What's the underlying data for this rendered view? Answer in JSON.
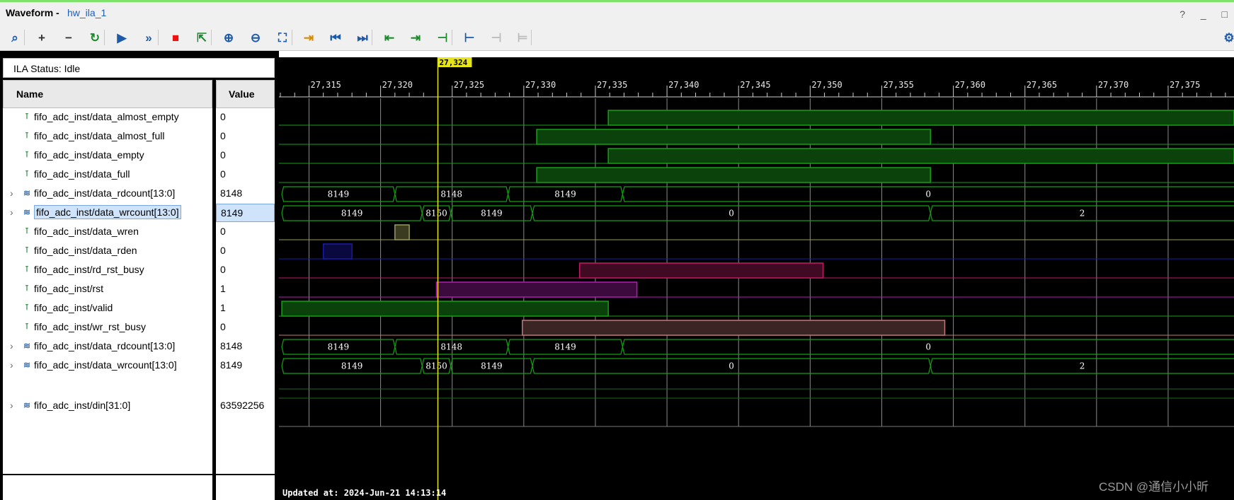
{
  "window": {
    "title": "Waveform -",
    "link": "hw_ila_1",
    "controls": "? _ □"
  },
  "toolbar": {
    "buttons": [
      {
        "name": "search-icon",
        "glyph": "⌕"
      },
      {
        "name": "add-icon",
        "glyph": "+"
      },
      {
        "name": "remove-icon",
        "glyph": "−"
      },
      {
        "name": "refresh-icon",
        "glyph": "↻"
      },
      {
        "name": "run-trigger-icon",
        "glyph": "▶"
      },
      {
        "name": "run-immediate-icon",
        "glyph": "»"
      },
      {
        "name": "stop-icon",
        "glyph": "■"
      },
      {
        "name": "export-icon",
        "glyph": "⇱"
      },
      {
        "name": "zoom-in-icon",
        "glyph": "⊕"
      },
      {
        "name": "zoom-out-icon",
        "glyph": "⊖"
      },
      {
        "name": "zoom-fit-icon",
        "glyph": "⛶"
      },
      {
        "name": "goto-cursor-icon",
        "glyph": "⇥"
      },
      {
        "name": "goto-start-icon",
        "glyph": "⏮"
      },
      {
        "name": "goto-end-icon",
        "glyph": "⏭"
      },
      {
        "name": "prev-transition-icon",
        "glyph": "⇤"
      },
      {
        "name": "next-transition-icon",
        "glyph": "⇥"
      },
      {
        "name": "add-marker-icon",
        "glyph": "⊣"
      },
      {
        "name": "prev-marker-icon",
        "glyph": "⊢"
      },
      {
        "name": "next-marker-icon",
        "glyph": "⊣"
      },
      {
        "name": "swap-cursors-icon",
        "glyph": "⊨"
      }
    ],
    "settings_icon": "gear-icon"
  },
  "ila_status": "ILA Status:  Idle",
  "columns": {
    "name": "Name",
    "value": "Value"
  },
  "signals": [
    {
      "name": "fifo_adc_inst/data_almost_empty",
      "value": "0",
      "bus": false
    },
    {
      "name": "fifo_adc_inst/data_almost_full",
      "value": "0",
      "bus": false
    },
    {
      "name": "fifo_adc_inst/data_empty",
      "value": "0",
      "bus": false
    },
    {
      "name": "fifo_adc_inst/data_full",
      "value": "0",
      "bus": false
    },
    {
      "name": "fifo_adc_inst/data_rdcount[13:0]",
      "value": "8148",
      "bus": true
    },
    {
      "name": "fifo_adc_inst/data_wrcount[13:0]",
      "value": "8149",
      "bus": true,
      "selected": true
    },
    {
      "name": "fifo_adc_inst/data_wren",
      "value": "0",
      "bus": false
    },
    {
      "name": "fifo_adc_inst/data_rden",
      "value": "0",
      "bus": false
    },
    {
      "name": "fifo_adc_inst/rd_rst_busy",
      "value": "0",
      "bus": false
    },
    {
      "name": "fifo_adc_inst/rst",
      "value": "1",
      "bus": false
    },
    {
      "name": "fifo_adc_inst/valid",
      "value": "1",
      "bus": false
    },
    {
      "name": "fifo_adc_inst/wr_rst_busy",
      "value": "0",
      "bus": false
    },
    {
      "name": "fifo_adc_inst/data_rdcount[13:0]",
      "value": "8148",
      "bus": true
    },
    {
      "name": "fifo_adc_inst/data_wrcount[13:0]",
      "value": "8149",
      "bus": true
    },
    {
      "name": "fifo_adc_inst/din[31:0]",
      "value": "63592256",
      "bus": true
    }
  ],
  "cursor": {
    "time": 27324,
    "label": "27,324",
    "color": "#e5e51a"
  },
  "timeline": {
    "ticks": [
      27315,
      27320,
      27325,
      27330,
      27335,
      27340,
      27345,
      27350,
      27355,
      27360,
      27365,
      27370,
      27375
    ],
    "tick_labels": [
      "27,315",
      "27,320",
      "27,325",
      "27,330",
      "27,335",
      "27,340",
      "27,345",
      "27,350",
      "27,355",
      "27,360",
      "27,365",
      "27,370",
      "27,375"
    ],
    "start": 27312.9,
    "end": 27379.6
  },
  "waves": [
    {
      "type": "bit",
      "color": "#14a014",
      "fill": "#0b420b",
      "high": [
        [
          27335.9,
          27380
        ]
      ]
    },
    {
      "type": "bit",
      "color": "#14a014",
      "fill": "#0b420b",
      "high": [
        [
          27330.9,
          27358.4
        ]
      ]
    },
    {
      "type": "bit",
      "color": "#14a014",
      "fill": "#0b420b",
      "high": [
        [
          27335.9,
          27380
        ]
      ]
    },
    {
      "type": "bit",
      "color": "#14a014",
      "fill": "#0b420b",
      "high": [
        [
          27330.9,
          27358.4
        ]
      ]
    },
    {
      "type": "bus",
      "color": "#14a014",
      "segments": [
        {
          "from": 27313.1,
          "to": 27321.0,
          "label": "8149"
        },
        {
          "from": 27321.0,
          "to": 27328.9,
          "label": "8148"
        },
        {
          "from": 27328.9,
          "to": 27336.9,
          "label": "8149"
        },
        {
          "from": 27336.9,
          "to": 27380,
          "label": "0"
        }
      ]
    },
    {
      "type": "bus",
      "color": "#14a014",
      "segments": [
        {
          "from": 27313.1,
          "to": 27322.9,
          "label": "8149"
        },
        {
          "from": 27322.9,
          "to": 27324.9,
          "label": "8150"
        },
        {
          "from": 27324.9,
          "to": 27330.6,
          "label": "8149"
        },
        {
          "from": 27330.6,
          "to": 27358.4,
          "label": "0"
        },
        {
          "from": 27358.4,
          "to": 27380,
          "label": "2"
        }
      ]
    },
    {
      "type": "bit",
      "color": "#9b9b5a",
      "fill": "#3b3b22",
      "high": [
        [
          27321.0,
          27322.0
        ]
      ]
    },
    {
      "type": "bit",
      "color": "#1a1aa8",
      "fill": "#090940",
      "high": [
        [
          27316.0,
          27318.0
        ]
      ]
    },
    {
      "type": "bit",
      "color": "#c01a68",
      "fill": "#400a22",
      "high": [
        [
          27333.9,
          27350.9
        ]
      ]
    },
    {
      "type": "bit",
      "color": "#b41ab4",
      "fill": "#3c0a3c",
      "high": [
        [
          27323.9,
          27337.9
        ]
      ]
    },
    {
      "type": "bit",
      "color": "#14a014",
      "fill": "#0b420b",
      "high": [
        [
          27313.1,
          27335.9
        ]
      ]
    },
    {
      "type": "bit",
      "color": "#c07878",
      "fill": "#3a2424",
      "high": [
        [
          27329.9,
          27359.4
        ]
      ]
    },
    {
      "type": "bus",
      "color": "#14a014",
      "segments": [
        {
          "from": 27313.1,
          "to": 27321.0,
          "label": "8149"
        },
        {
          "from": 27321.0,
          "to": 27328.9,
          "label": "8148"
        },
        {
          "from": 27328.9,
          "to": 27336.9,
          "label": "8149"
        },
        {
          "from": 27336.9,
          "to": 27380,
          "label": "0"
        }
      ]
    },
    {
      "type": "bus",
      "color": "#14a014",
      "segments": [
        {
          "from": 27313.1,
          "to": 27322.9,
          "label": "8149"
        },
        {
          "from": 27322.9,
          "to": 27324.9,
          "label": "8150"
        },
        {
          "from": 27324.9,
          "to": 27330.6,
          "label": "8149"
        },
        {
          "from": 27330.6,
          "to": 27358.4,
          "label": "0"
        },
        {
          "from": 27358.4,
          "to": 27380,
          "label": "2"
        }
      ]
    },
    {
      "type": "din",
      "color": "#14a014"
    }
  ],
  "updated": "Updated at: 2024-Jun-21 14:13:14",
  "watermark": "CSDN @通信小小昕"
}
